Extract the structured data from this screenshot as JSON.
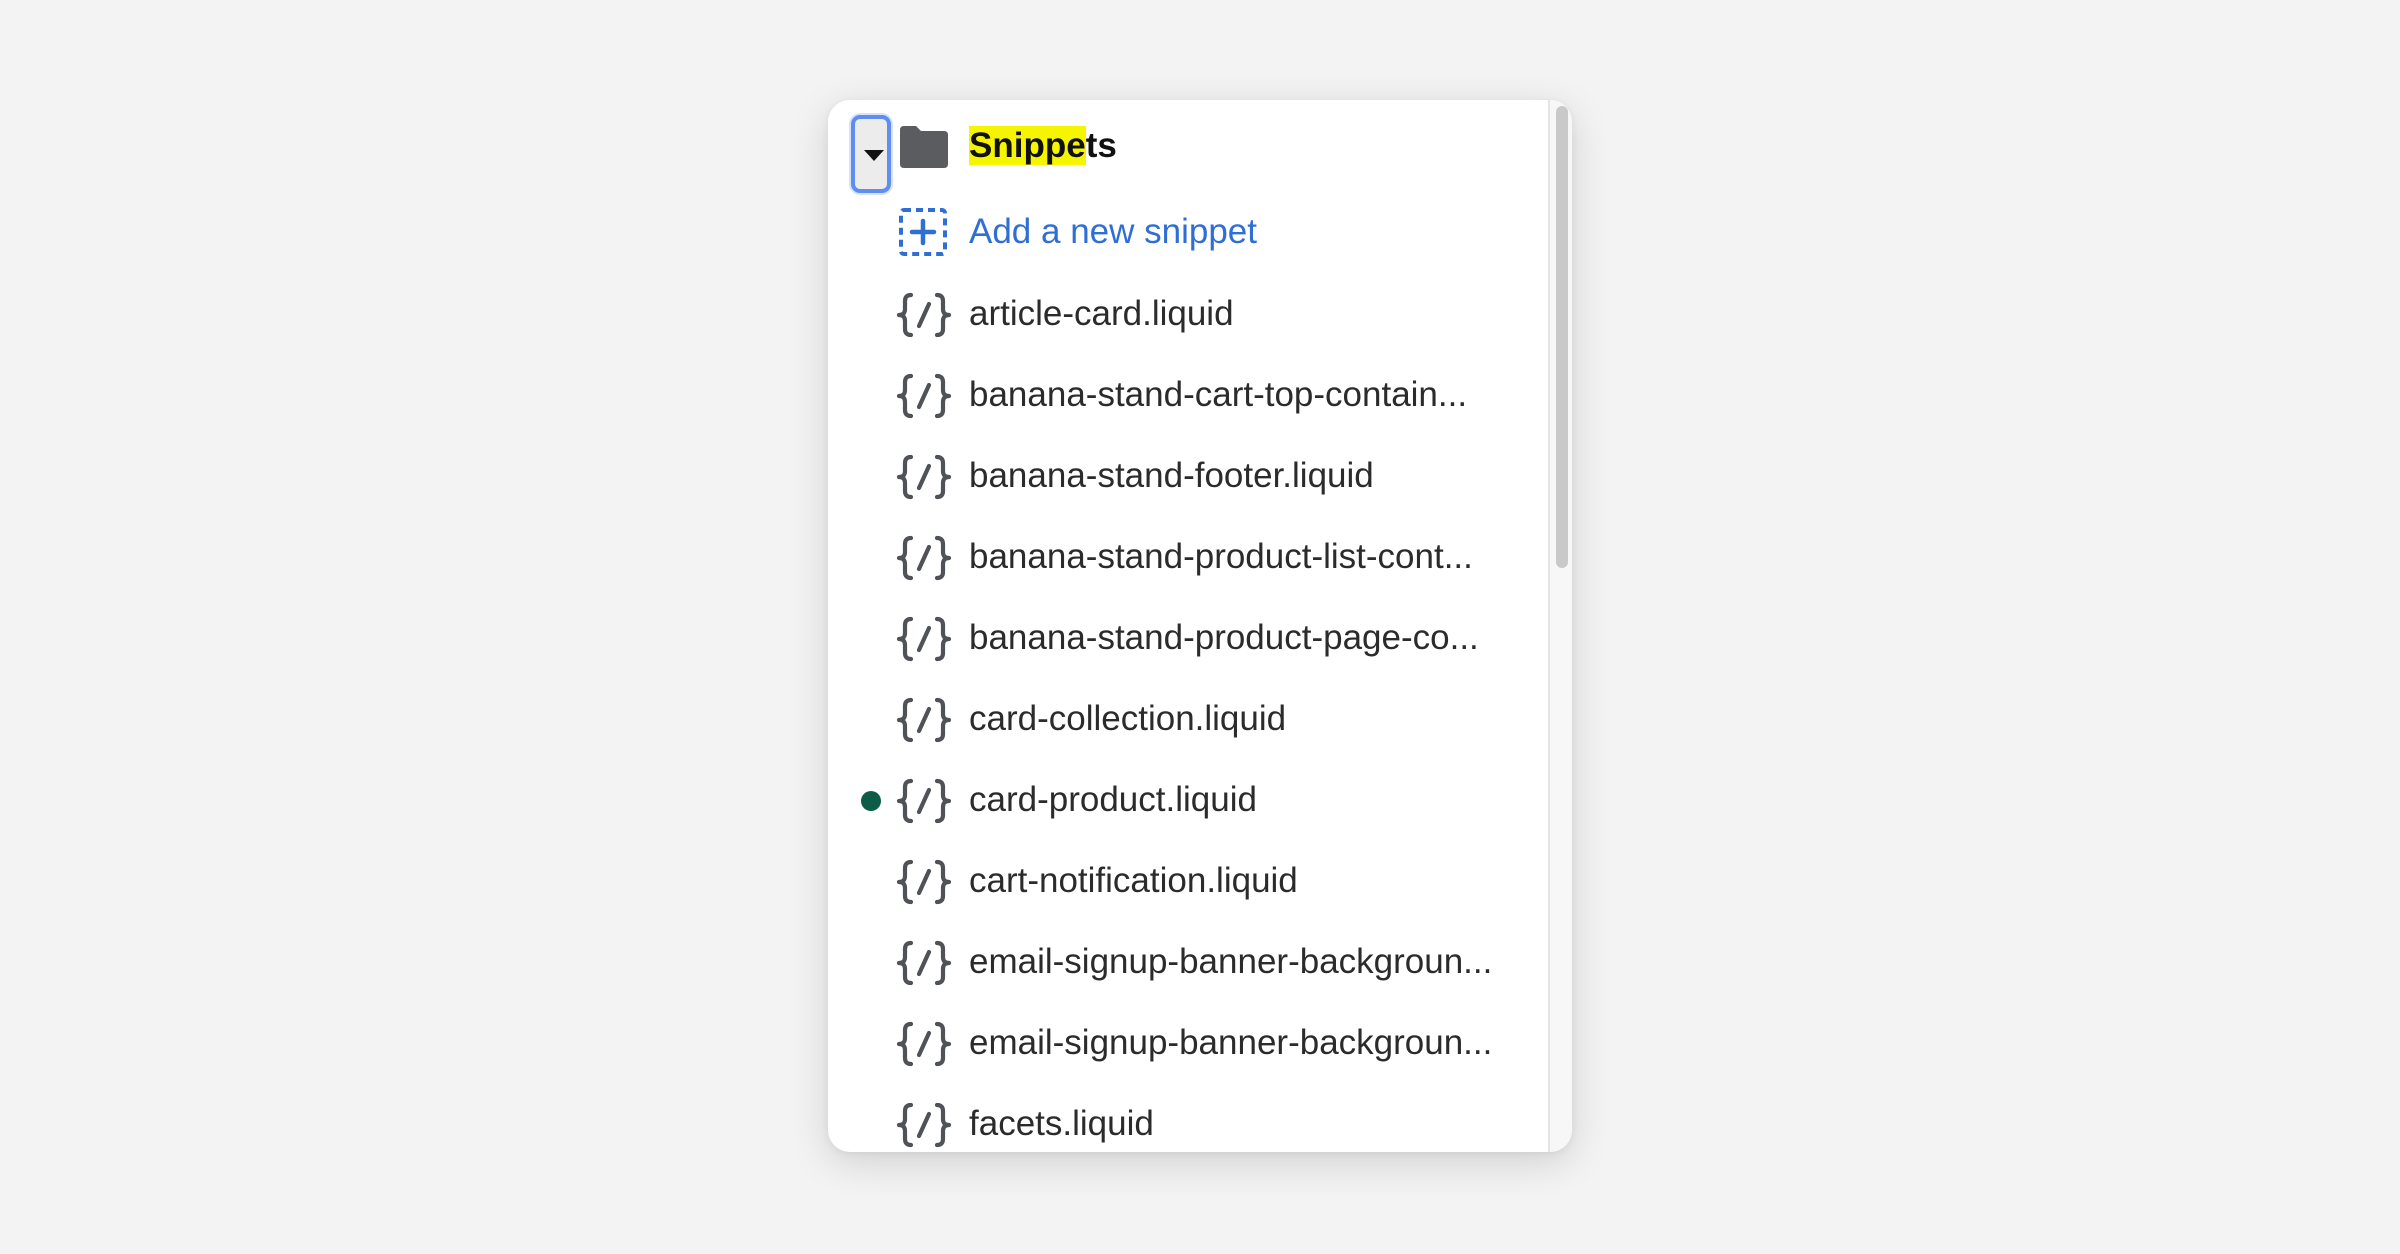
{
  "folder": {
    "name_highlighted": "Snippe",
    "name_rest": "ts",
    "icon": "folder-icon",
    "expanded": true
  },
  "add_item": {
    "label": "Add a new snippet",
    "icon": "add-dashed-square-icon",
    "color": "#2f6fd4"
  },
  "files": [
    {
      "name": "article-card.liquid",
      "modified": false
    },
    {
      "name": "banana-stand-cart-top-contain...",
      "modified": false
    },
    {
      "name": "banana-stand-footer.liquid",
      "modified": false
    },
    {
      "name": "banana-stand-product-list-cont...",
      "modified": false
    },
    {
      "name": "banana-stand-product-page-co...",
      "modified": false
    },
    {
      "name": "card-collection.liquid",
      "modified": false
    },
    {
      "name": "card-product.liquid",
      "modified": true
    },
    {
      "name": "cart-notification.liquid",
      "modified": false
    },
    {
      "name": "email-signup-banner-backgroun...",
      "modified": false
    },
    {
      "name": "email-signup-banner-backgroun...",
      "modified": false
    },
    {
      "name": "facets.liquid",
      "modified": false
    }
  ],
  "colors": {
    "highlight": "#f5f500",
    "modified_dot": "#0e5c48",
    "focus_ring": "#5e8ff0"
  }
}
